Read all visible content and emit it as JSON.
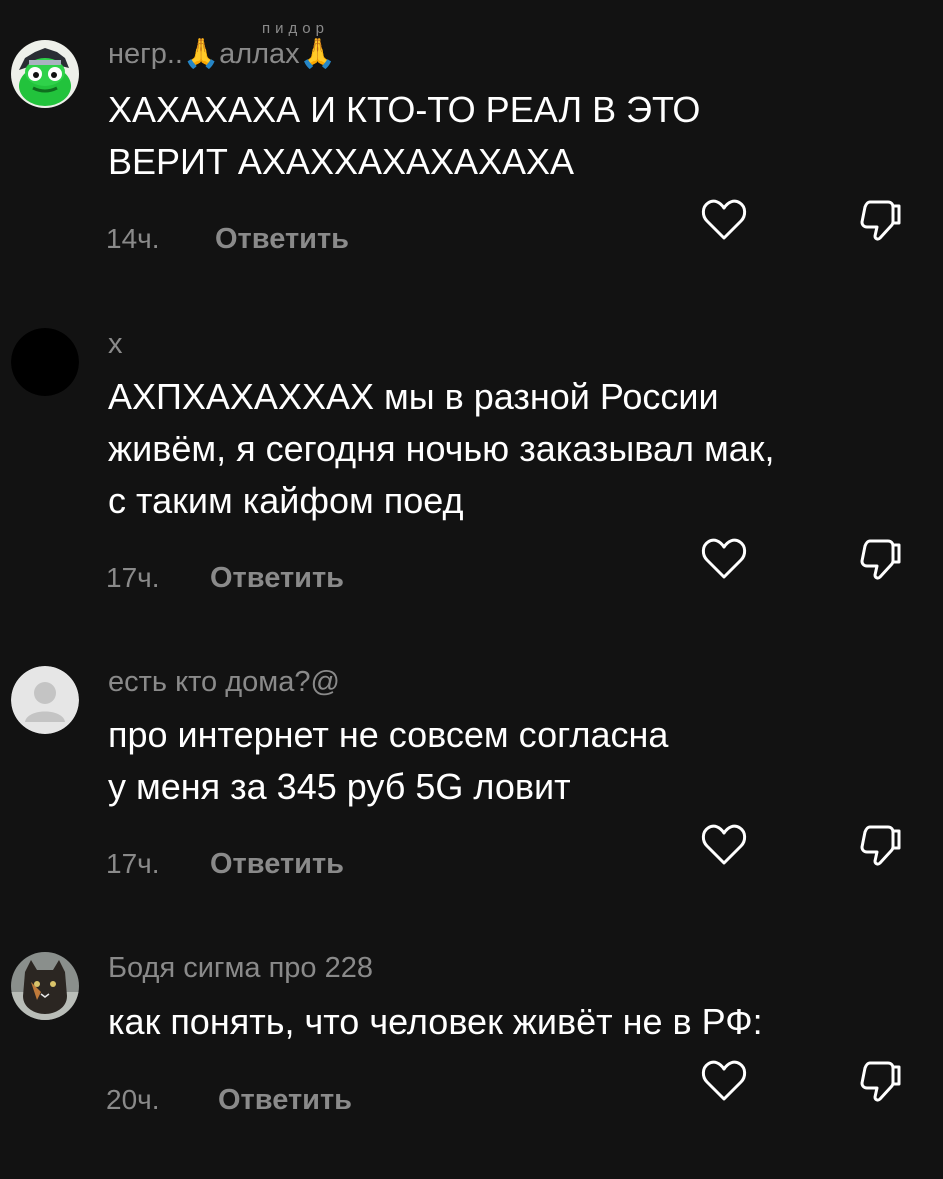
{
  "comments": [
    {
      "username": "негр..🙏аллах🙏",
      "username_deco": "пидор",
      "lines": [
        "ХАХАХАХА И КТО-ТО РЕАЛ В ЭТО",
        "ВЕРИТ АХАХХАХАХАХАХА"
      ],
      "time": "14ч.",
      "reply": "Ответить",
      "avatar": "green-frog-avatar"
    },
    {
      "username": "x",
      "lines": [
        "АХПХАХАХХАХ мы в разной России",
        "живём, я сегодня ночью заказывал мак,",
        "с таким кайфом поед"
      ],
      "time": "17ч.",
      "reply": "Ответить",
      "avatar": "black-avatar"
    },
    {
      "username": "есть кто дома?@",
      "lines": [
        "про интернет не совсем согласна",
        "у меня за 345 руб 5G ловит"
      ],
      "time": "17ч.",
      "reply": "Ответить",
      "avatar": "default-avatar"
    },
    {
      "username": "Бодя сигма про 228",
      "lines": [
        "как понять, что человек живёт не в РФ:"
      ],
      "time": "20ч.",
      "reply": "Ответить",
      "avatar": "cat-avatar"
    }
  ],
  "colors": {
    "background": "#121212",
    "text": "#ffffff",
    "secondary": "#8a8a8a"
  }
}
